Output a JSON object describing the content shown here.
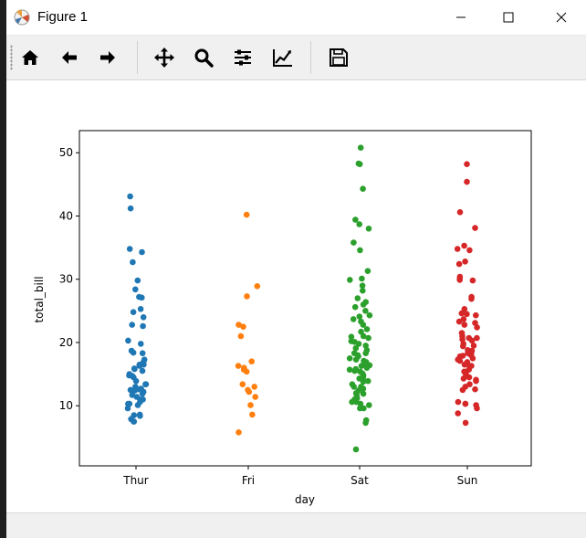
{
  "window": {
    "title": "Figure 1"
  },
  "toolbar": {
    "buttons": [
      {
        "name": "home-icon",
        "tooltip": "Home"
      },
      {
        "name": "back-arrow-icon",
        "tooltip": "Back"
      },
      {
        "name": "forward-arrow-icon",
        "tooltip": "Forward"
      },
      {
        "name": "pan-icon",
        "tooltip": "Pan"
      },
      {
        "name": "zoom-icon",
        "tooltip": "Zoom"
      },
      {
        "name": "subplots-icon",
        "tooltip": "Subplots"
      },
      {
        "name": "customize-icon",
        "tooltip": "Customize"
      },
      {
        "name": "save-icon",
        "tooltip": "Save"
      }
    ]
  },
  "chart_data": {
    "type": "scatter",
    "xlabel": "day",
    "ylabel": "total_bill",
    "categories": [
      "Thur",
      "Fri",
      "Sat",
      "Sun"
    ],
    "ylim": [
      0.5,
      53.5
    ],
    "yticks": [
      10,
      20,
      30,
      40,
      50
    ],
    "colors": [
      "#1f77b4",
      "#ff7f0e",
      "#2ca02c",
      "#d62728"
    ],
    "series": [
      {
        "values": [
          27.2,
          22.8,
          12.6,
          13.4,
          16.3,
          16.5,
          10.3,
          16.5,
          11.0,
          18.3,
          19.8,
          32.7,
          34.3,
          34.8,
          29.8,
          41.2,
          43.1,
          27.1,
          24.0,
          22.6,
          20.3,
          28.4,
          25.3,
          24.8,
          18.7,
          18.4,
          17.3,
          16.9,
          15.9,
          15.8,
          15.5,
          15.0,
          14.8,
          14.7,
          14.5,
          13.9,
          13.4,
          13.0,
          12.7,
          12.5,
          12.4,
          12.2,
          11.9,
          11.7,
          11.4,
          11.0,
          10.6,
          10.3,
          10.1,
          9.6,
          8.6,
          8.5,
          8.4,
          7.9,
          7.5,
          7.5
        ]
      },
      {
        "values": [
          40.2,
          28.9,
          27.3,
          22.8,
          22.5,
          21.0,
          17.0,
          16.3,
          16.0,
          15.7,
          15.4,
          13.4,
          13.0,
          12.5,
          12.2,
          11.4,
          10.1,
          8.6,
          5.8
        ]
      },
      {
        "values": [
          50.8,
          48.3,
          48.2,
          44.3,
          39.4,
          38.7,
          38.0,
          35.8,
          34.6,
          31.3,
          30.1,
          29.9,
          29.0,
          28.2,
          27.0,
          26.4,
          26.0,
          25.6,
          25.0,
          24.3,
          24.1,
          23.7,
          23.3,
          22.8,
          22.1,
          21.7,
          21.0,
          20.9,
          20.7,
          20.2,
          20.1,
          19.8,
          19.5,
          19.1,
          18.8,
          18.3,
          18.3,
          18.0,
          17.8,
          17.5,
          17.3,
          17.1,
          16.9,
          16.6,
          16.4,
          16.3,
          16.0,
          15.8,
          15.7,
          15.5,
          15.4,
          15.1,
          14.8,
          14.5,
          14.3,
          14.1,
          13.9,
          13.8,
          13.4,
          13.0,
          13.0,
          12.7,
          12.4,
          12.0,
          11.9,
          11.7,
          11.2,
          11.0,
          10.6,
          10.6,
          10.3,
          10.1,
          9.6,
          9.6,
          7.7,
          7.3,
          3.1
        ]
      },
      {
        "values": [
          48.2,
          45.4,
          40.6,
          38.1,
          35.3,
          34.8,
          34.6,
          32.8,
          32.4,
          30.4,
          30.1,
          29.9,
          29.8,
          27.2,
          26.9,
          25.3,
          24.6,
          24.5,
          24.3,
          23.7,
          23.3,
          23.1,
          22.8,
          22.4,
          21.5,
          21.0,
          20.7,
          20.7,
          20.5,
          20.3,
          19.8,
          19.5,
          19.4,
          18.8,
          18.7,
          18.3,
          18.2,
          18.0,
          17.9,
          17.8,
          17.5,
          17.3,
          17.1,
          16.9,
          16.6,
          16.5,
          16.3,
          16.2,
          15.7,
          15.4,
          15.0,
          14.8,
          14.5,
          14.3,
          14.1,
          13.9,
          13.4,
          13.0,
          12.6,
          12.5,
          10.6,
          10.3,
          10.3,
          10.1,
          9.6,
          8.8,
          7.3
        ]
      }
    ]
  }
}
